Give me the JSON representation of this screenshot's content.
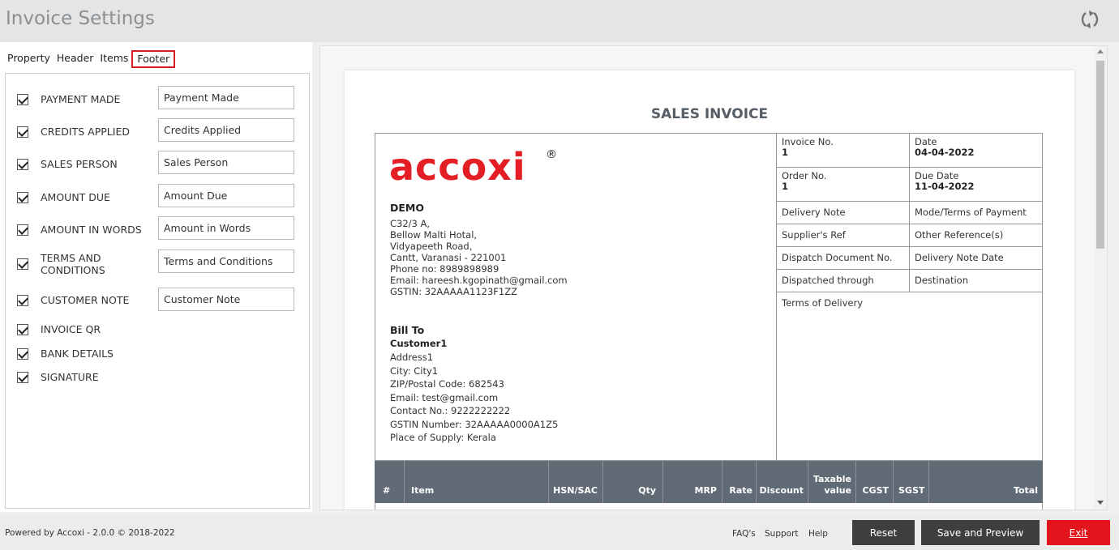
{
  "header": {
    "title": "Invoice Settings",
    "refresh_icon": "refresh-icon"
  },
  "tabs": [
    {
      "label": "Property",
      "active": false
    },
    {
      "label": "Header",
      "active": false
    },
    {
      "label": "Items",
      "active": false
    },
    {
      "label": "Footer",
      "active": true
    }
  ],
  "options": [
    {
      "label": "PAYMENT MADE",
      "checked": true,
      "value": "Payment Made"
    },
    {
      "label": "CREDITS APPLIED",
      "checked": true,
      "value": "Credits Applied"
    },
    {
      "label": "SALES PERSON",
      "checked": true,
      "value": "Sales Person"
    },
    {
      "label": "AMOUNT DUE",
      "checked": true,
      "value": "Amount Due"
    },
    {
      "label": "AMOUNT IN WORDS",
      "checked": true,
      "value": "Amount in Words"
    },
    {
      "label": "TERMS AND CONDITIONS",
      "checked": true,
      "value": "Terms and Conditions"
    },
    {
      "label": "CUSTOMER NOTE",
      "checked": true,
      "value": "Customer Note"
    },
    {
      "label": "INVOICE QR",
      "checked": true
    },
    {
      "label": "BANK DETAILS",
      "checked": true
    },
    {
      "label": "SIGNATURE",
      "checked": true
    }
  ],
  "invoice": {
    "title": "SALES INVOICE",
    "logo_text": "accoxi",
    "logo_reg": "®",
    "brand_color": "#e31e24",
    "company": {
      "name": "DEMO",
      "lines": [
        "C32/3 A,",
        "Bellow Malti Hotal,",
        "Vidyapeeth Road,",
        "Cantt, Varanasi - 221001",
        "Phone no: 8989898989",
        "Email: hareesh.kgopinath@gmail.com",
        "GSTIN: 32AAAAA1123F1ZZ"
      ]
    },
    "bill_to": {
      "title": "Bill To",
      "name": "Customer1",
      "lines": [
        "Address1",
        "City: City1",
        "ZIP/Postal Code: 682543",
        "Email: test@gmail.com",
        "Contact No.: 9222222222",
        "GSTIN Number: 32AAAAA0000A1Z5",
        "Place of Supply: Kerala"
      ]
    },
    "meta": {
      "invoice_no_label": "Invoice No.",
      "invoice_no": "1",
      "date_label": "Date",
      "date": "04-04-2022",
      "order_no_label": "Order No.",
      "order_no": "1",
      "due_date_label": "Due Date",
      "due_date": "11-04-2022",
      "delivery_note": "Delivery Note",
      "mode_terms": "Mode/Terms of Payment",
      "suppliers_ref": "Supplier's Ref",
      "other_refs": "Other Reference(s)",
      "dispatch_doc": "Dispatch Document No.",
      "delivery_note_date": "Delivery Note Date",
      "dispatched_through": "Dispatched through",
      "destination": "Destination",
      "terms_of_delivery": "Terms of Delivery"
    },
    "items_header": {
      "no": "#",
      "item": "Item",
      "hsn": "HSN/SAC",
      "qty": "Qty",
      "mrp": "MRP",
      "rate": "Rate",
      "discount": "Discount",
      "taxable_1": "Taxable",
      "taxable_2": "value",
      "cgst": "CGST",
      "sgst": "SGST",
      "total": "Total"
    }
  },
  "footer": {
    "powered": "Powered by Accoxi - 2.0.0 © 2018-2022",
    "faqs": "FAQ's",
    "support": "Support",
    "help": "Help",
    "reset": "Reset",
    "save_preview": "Save and Preview",
    "exit": "Exit"
  }
}
